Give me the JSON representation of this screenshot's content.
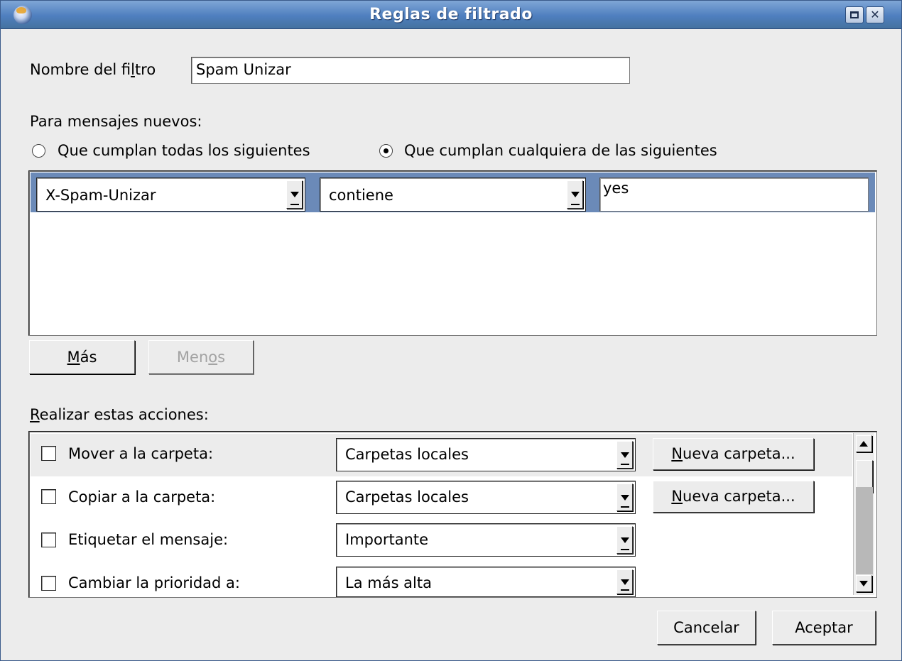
{
  "window": {
    "title": "Reglas de filtrado",
    "max_icon": "maximize-icon",
    "close_icon": "close-icon",
    "close_glyph": "✕"
  },
  "filter_name": {
    "label_pre": "Nombre del fi",
    "label_u": "l",
    "label_post": "tro",
    "value": "Spam Unizar"
  },
  "conditions": {
    "heading": "Para mensajes nuevos:",
    "match_all_label": "Que cumplan todas los siguientes",
    "match_any_label": "Que cumplan cualquiera de las siguientes",
    "selected": "any",
    "rules": [
      {
        "field": "X-Spam-Unizar",
        "operator": "contiene",
        "value": "yes"
      }
    ],
    "more_button": {
      "u": "M",
      "post": "ás"
    },
    "less_button": {
      "pre": "Men",
      "u": "o",
      "post": "s"
    }
  },
  "actions": {
    "heading_u": "R",
    "heading_post": "ealizar estas acciones:",
    "rows": [
      {
        "label": "Mover a la carpeta:",
        "select": "Carpetas locales",
        "button_u": "N",
        "button_post": "ueva carpeta...",
        "checked": false
      },
      {
        "label": "Copiar a la carpeta:",
        "select": "Carpetas locales",
        "button_u": "N",
        "button_post": "ueva carpeta...",
        "checked": false
      },
      {
        "label": "Etiquetar el mensaje:",
        "select": "Importante",
        "checked": false
      },
      {
        "label": "Cambiar la prioridad a:",
        "select": "La más alta",
        "checked": false
      }
    ]
  },
  "footer": {
    "cancel_label": "Cancelar",
    "ok_label": "Aceptar"
  },
  "colors": {
    "titlebar": "#4f7fbf",
    "rule_row_selected": "#6b8ab8",
    "window_bg": "#ececec"
  }
}
